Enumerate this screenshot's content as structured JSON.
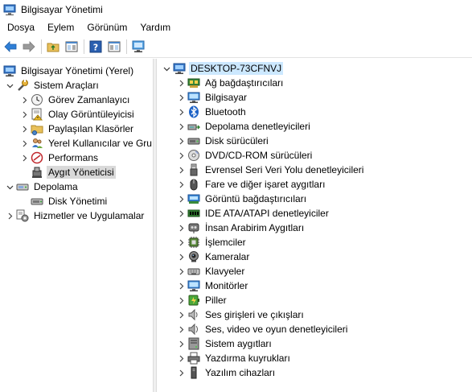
{
  "window": {
    "title": "Bilgisayar Yönetimi"
  },
  "menu": [
    "Dosya",
    "Eylem",
    "Görünüm",
    "Yardım"
  ],
  "left_tree": [
    {
      "label": "Bilgisayar Yönetimi (Yerel)",
      "icon": "computer-mgmt-icon",
      "level": 0,
      "expander": ""
    },
    {
      "label": "Sistem Araçları",
      "icon": "tools-icon",
      "level": 1,
      "expander": "expanded"
    },
    {
      "label": "Görev Zamanlayıcı",
      "icon": "clock-icon",
      "level": 2,
      "expander": "collapsed"
    },
    {
      "label": "Olay Görüntüleyicisi",
      "icon": "event-viewer-icon",
      "level": 2,
      "expander": "collapsed"
    },
    {
      "label": "Paylaşılan Klasörler",
      "icon": "shared-folder-icon",
      "level": 2,
      "expander": "collapsed"
    },
    {
      "label": "Yerel Kullanıcılar ve Gru",
      "icon": "users-icon",
      "level": 2,
      "expander": "collapsed"
    },
    {
      "label": "Performans",
      "icon": "performance-icon",
      "level": 2,
      "expander": "collapsed"
    },
    {
      "label": "Aygıt Yöneticisi",
      "icon": "device-manager-icon",
      "level": 2,
      "expander": "",
      "selected": true
    },
    {
      "label": "Depolama",
      "icon": "storage-icon",
      "level": 1,
      "expander": "expanded"
    },
    {
      "label": "Disk Yönetimi",
      "icon": "disk-mgmt-icon",
      "level": 2,
      "expander": ""
    },
    {
      "label": "Hizmetler ve Uygulamalar",
      "icon": "services-icon",
      "level": 1,
      "expander": "collapsed"
    }
  ],
  "device_tree": {
    "root": "DESKTOP-73CFNVJ",
    "categories": [
      {
        "label": "Ağ bağdaştırıcıları",
        "icon": "network-adapter-icon"
      },
      {
        "label": "Bilgisayar",
        "icon": "monitor-icon"
      },
      {
        "label": "Bluetooth",
        "icon": "bluetooth-icon"
      },
      {
        "label": "Depolama denetleyicileri",
        "icon": "storage-controller-icon"
      },
      {
        "label": "Disk sürücüleri",
        "icon": "disk-drive-icon"
      },
      {
        "label": "DVD/CD-ROM sürücüleri",
        "icon": "dvd-icon"
      },
      {
        "label": "Evrensel Seri Veri Yolu denetleyicileri",
        "icon": "usb-icon"
      },
      {
        "label": "Fare ve diğer işaret aygıtları",
        "icon": "mouse-icon"
      },
      {
        "label": "Görüntü bağdaştırıcıları",
        "icon": "display-adapter-icon"
      },
      {
        "label": "IDE ATA/ATAPI denetleyiciler",
        "icon": "ide-icon"
      },
      {
        "label": "İnsan Arabirim Aygıtları",
        "icon": "hid-icon"
      },
      {
        "label": "İşlemciler",
        "icon": "processor-icon"
      },
      {
        "label": "Kameralar",
        "icon": "camera-icon"
      },
      {
        "label": "Klavyeler",
        "icon": "keyboard-icon"
      },
      {
        "label": "Monitörler",
        "icon": "monitor-icon"
      },
      {
        "label": "Piller",
        "icon": "battery-icon"
      },
      {
        "label": "Ses girişleri ve çıkışları",
        "icon": "speaker-icon"
      },
      {
        "label": "Ses, video ve oyun denetleyicileri",
        "icon": "sound-icon"
      },
      {
        "label": "Sistem aygıtları",
        "icon": "system-device-icon"
      },
      {
        "label": "Yazdırma kuyrukları",
        "icon": "printer-icon"
      },
      {
        "label": "Yazılım cihazları",
        "icon": "software-device-icon"
      }
    ]
  }
}
